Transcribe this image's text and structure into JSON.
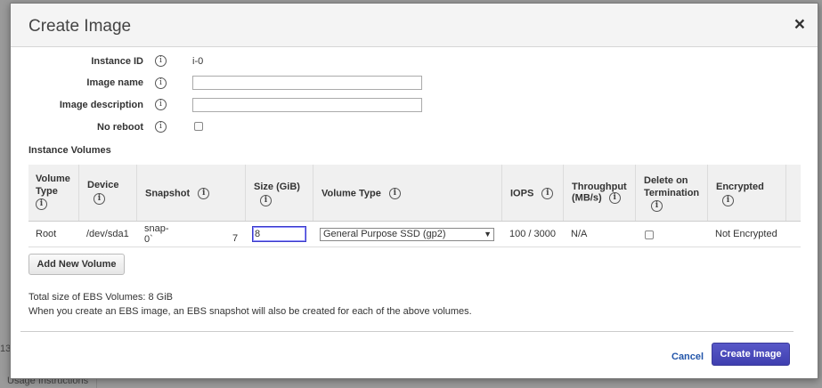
{
  "background": {
    "left_fragment": "13",
    "bottom_link": "Usage Instructions"
  },
  "modal": {
    "title": "Create Image",
    "close_glyph": "×"
  },
  "form": {
    "instance_id_label": "Instance ID",
    "instance_id_value": "i-0",
    "image_name_label": "Image name",
    "image_name_value": "",
    "image_description_label": "Image description",
    "image_description_value": "",
    "no_reboot_label": "No reboot",
    "no_reboot_checked": false,
    "info_glyph": "i"
  },
  "volumes": {
    "section_title": "Instance Volumes",
    "columns": [
      {
        "key": "volume_type",
        "label_line1": "Volume",
        "label_line2": "Type"
      },
      {
        "key": "device",
        "label_line1": "Device",
        "label_line2": ""
      },
      {
        "key": "snapshot",
        "label_line1": "Snapshot",
        "label_line2": ""
      },
      {
        "key": "size",
        "label_line1": "Size (GiB)",
        "label_line2": ""
      },
      {
        "key": "ebs_volume_type",
        "label_line1": "Volume Type",
        "label_line2": ""
      },
      {
        "key": "iops",
        "label_line1": "IOPS",
        "label_line2": ""
      },
      {
        "key": "throughput",
        "label_line1": "Throughput",
        "label_line2": "(MB/s)"
      },
      {
        "key": "delete_on_termination",
        "label_line1": "Delete on",
        "label_line2": "Termination"
      },
      {
        "key": "encrypted",
        "label_line1": "Encrypted",
        "label_line2": ""
      }
    ],
    "rows": [
      {
        "volume_type": "Root",
        "device": "/dev/sda1",
        "snapshot_line1": "snap-",
        "snapshot_line2": "0`",
        "snapshot_suffix": "7",
        "size": "8",
        "ebs_volume_type": "General Purpose SSD (gp2)",
        "iops": "100 / 3000",
        "throughput": "N/A",
        "delete_on_termination": false,
        "encrypted": "Not Encrypted"
      }
    ],
    "add_button": "Add New Volume",
    "total_size": "Total size of EBS Volumes: 8 GiB",
    "note": "When you create an EBS image, an EBS snapshot will also be created for each of the above volumes."
  },
  "footer": {
    "cancel": "Cancel",
    "create": "Create Image"
  },
  "colors": {
    "primary_button": "#4848b8",
    "link": "#2255aa"
  }
}
